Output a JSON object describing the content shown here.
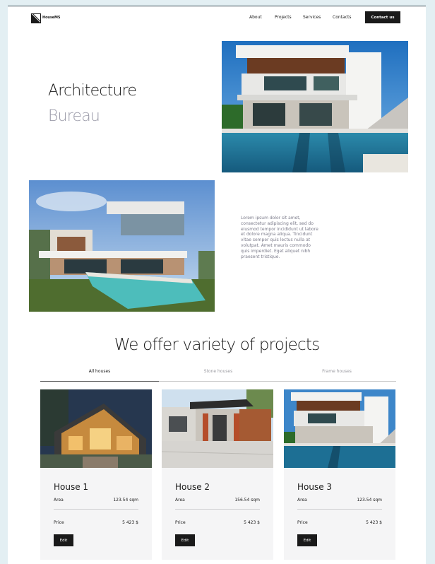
{
  "header": {
    "logo_text": "HouseMS",
    "nav": [
      "About",
      "Projects",
      "Services",
      "Contacts"
    ],
    "cta_label": "Contact us"
  },
  "hero": {
    "title": "Architecture",
    "subtitle": "Bureau"
  },
  "about": {
    "paragraph": "Lorem ipsum dolor sit amet, consectetur adipiscing elit, sed do eiusmod tempor incididunt ut labore et dolore magna aliqua. Tincidunt vitae semper quis lectus nulla at volutpat. Amet mauris commodo quis imperdiet. Eget aliquet nibh praesent tristique."
  },
  "projects": {
    "title": "We offer variety of projects",
    "tabs": [
      {
        "label": "All houses",
        "active": true
      },
      {
        "label": "Stone houses",
        "active": false
      },
      {
        "label": "Frame houses",
        "active": false
      }
    ],
    "cards": [
      {
        "name": "House 1",
        "area_label": "Area",
        "area": "123.54 sqm",
        "price_label": "Price",
        "price": "5 423 $",
        "button": "Edit"
      },
      {
        "name": "House 2",
        "area_label": "Area",
        "area": "156.54 sqm",
        "price_label": "Price",
        "price": "5 423 $",
        "button": "Edit"
      },
      {
        "name": "House 3",
        "area_label": "Area",
        "area": "123.54 sqm",
        "price_label": "Price",
        "price": "5 423 $",
        "button": "Edit"
      }
    ]
  },
  "colors": {
    "background": "#e3eff3",
    "primary_button": "#1a1a1a",
    "muted_text": "#9a9aa8"
  }
}
